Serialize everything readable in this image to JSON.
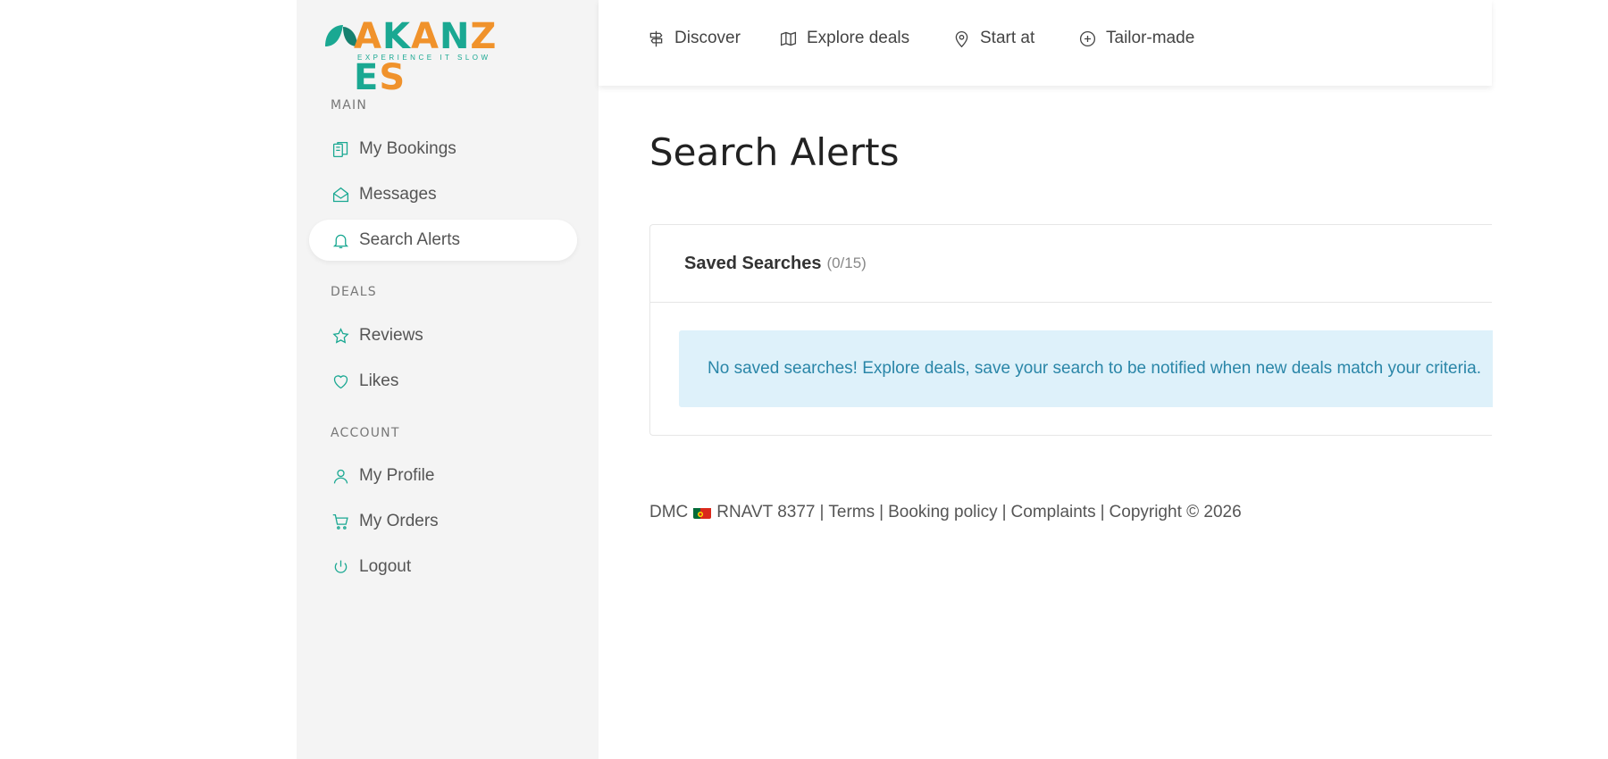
{
  "brand": {
    "logo_text": "AKANZES",
    "tagline": "EXPERIENCE IT SLOW",
    "colors": {
      "teal": "#1aa892",
      "orange": "#f0922b"
    }
  },
  "topnav": {
    "items": [
      {
        "label": "Discover",
        "icon": "signpost-icon"
      },
      {
        "label": "Explore deals",
        "icon": "map-icon"
      },
      {
        "label": "Start at",
        "icon": "map-pin-icon"
      },
      {
        "label": "Tailor-made",
        "icon": "plus-circle-icon"
      }
    ]
  },
  "sidebar": {
    "sections": [
      "MAIN",
      "DEALS",
      "ACCOUNT"
    ],
    "items": [
      {
        "label": "My Bookings",
        "icon": "bookings-icon"
      },
      {
        "label": "Messages",
        "icon": "envelope-icon"
      },
      {
        "label": "Search Alerts",
        "icon": "bell-icon",
        "active": true
      },
      {
        "label": "Reviews",
        "icon": "star-icon"
      },
      {
        "label": "Likes",
        "icon": "heart-icon"
      },
      {
        "label": "My Profile",
        "icon": "user-icon"
      },
      {
        "label": "My Orders",
        "icon": "cart-icon"
      },
      {
        "label": "Logout",
        "icon": "power-icon"
      }
    ]
  },
  "main": {
    "title": "Search Alerts",
    "card": {
      "title": "Saved Searches",
      "count": "(0/15)",
      "empty_message": "No saved searches! Explore deals, save your search to be notified when new deals match your criteria."
    }
  },
  "footer": {
    "dmc": "DMC",
    "rnavt": "RNAVT 8377",
    "terms": "Terms",
    "booking_policy": "Booking policy",
    "complaints": "Complaints",
    "copyright": "Copyright © 2026",
    "separator": "|"
  }
}
